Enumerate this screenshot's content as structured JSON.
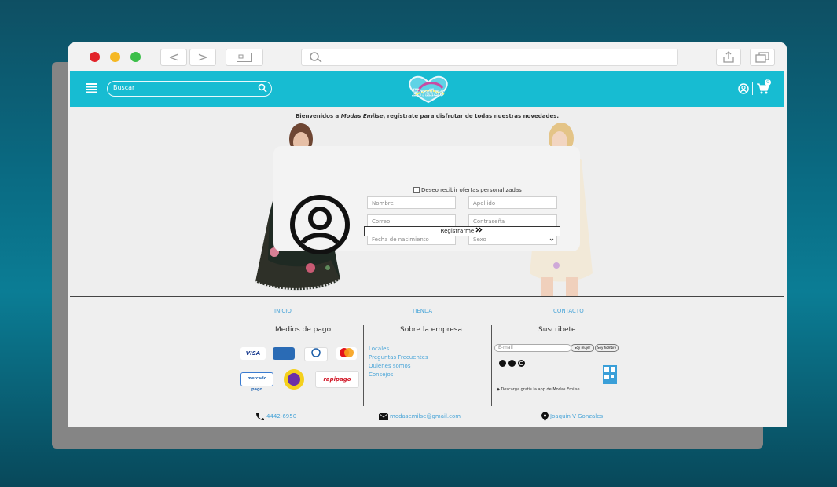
{
  "header": {
    "search_placeholder": "Buscar"
  },
  "welcome": {
    "prefix": "Bienvenidos a ",
    "brand": "Modas Emilse",
    "suffix": ", regístrate para disfrutar de todas nuestras novedades."
  },
  "form": {
    "nombre": "Nombre",
    "apellido": "Apellido",
    "correo": "Correo",
    "contrasena": "Contraseña",
    "fecha": "Fecha de nacimiento",
    "sexo": "Sexo",
    "checkbox_label": "Deseo recibir ofertas personalizadas",
    "submit": "Registrarme"
  },
  "footer": {
    "nav": [
      "INICIO",
      "TIENDA",
      "CONTACTO"
    ],
    "payments_title": "Medios de pago",
    "company_title": "Sobre la empresa",
    "company_links": [
      "Locales",
      "Preguntas Frecuentes",
      "Quiénes somos",
      "Consejos"
    ],
    "subscribe_title": "Suscribete",
    "email_placeholder": "E-mail",
    "btn_mujer": "Soy mujer",
    "btn_hombre": "Soy hombre",
    "app_text": "Descarga gratis la app de Modas Emilse",
    "phone": "4442-6950",
    "email": "modasemilse@gmail.com",
    "address": "Joaquín V Gonzales",
    "payment_labels": [
      "VISA",
      "mercado pago",
      "rapipago"
    ]
  },
  "cart": {
    "count": "0"
  },
  "colors": {
    "primary": "#17bcd2",
    "link": "#4aa5d8"
  }
}
